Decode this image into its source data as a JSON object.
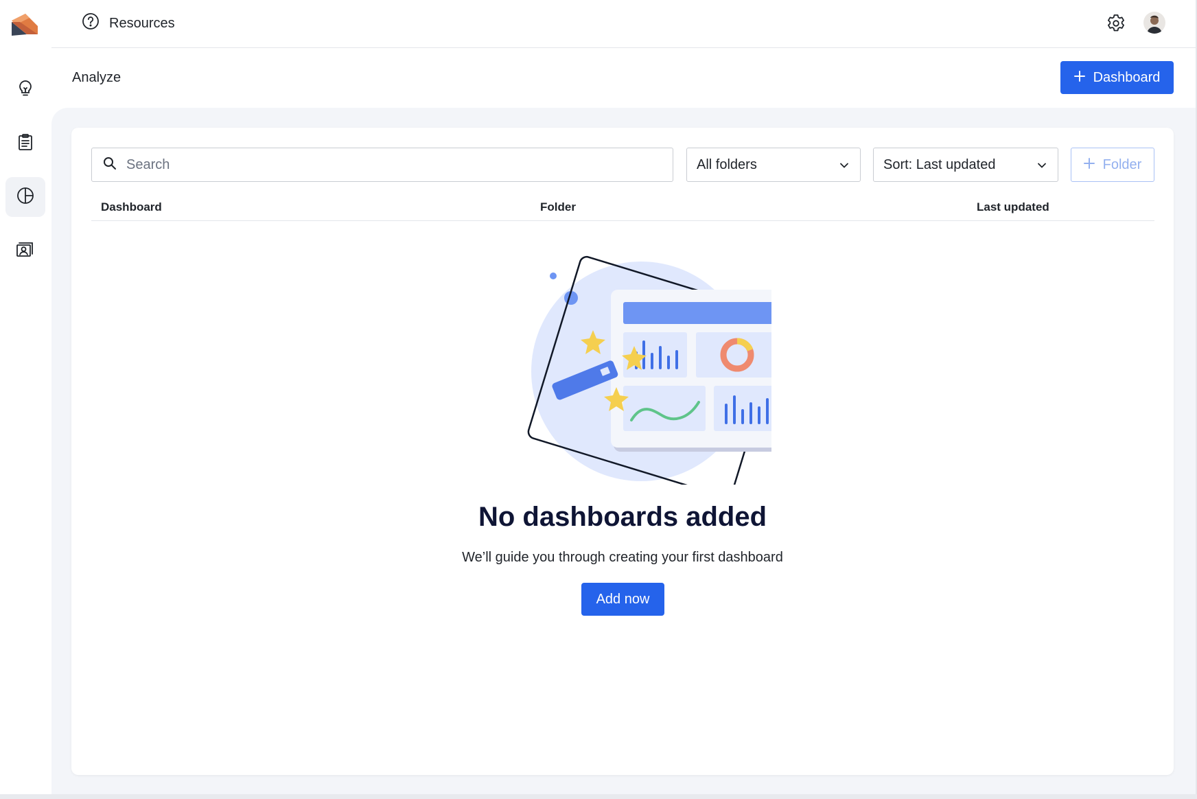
{
  "topbar": {
    "resources_label": "Resources"
  },
  "header": {
    "title": "Analyze",
    "new_dashboard_label": "Dashboard"
  },
  "filters": {
    "search_placeholder": "Search",
    "search_value": "",
    "folder_select": "All folders",
    "sort_select": "Sort: Last updated",
    "new_folder_label": "Folder"
  },
  "table": {
    "columns": [
      "Dashboard",
      "Folder",
      "Last updated"
    ],
    "rows": []
  },
  "empty_state": {
    "title": "No dashboards added",
    "subtitle": "We’ll guide you through creating your first dashboard",
    "cta_label": "Add now"
  },
  "icons": {
    "logo": "app-logo",
    "sidebar": [
      "lightbulb-icon",
      "clipboard-icon",
      "pie-chart-icon",
      "contact-card-icon"
    ],
    "topbar": [
      "help-circle-icon",
      "gear-icon"
    ]
  },
  "colors": {
    "primary": "#2563eb",
    "illustration_blue": "#6e95f3",
    "illustration_bg": "#e0e8fd",
    "star": "#f5cf4f",
    "donut": "#ef8a6f",
    "line": "#5fc48a"
  }
}
